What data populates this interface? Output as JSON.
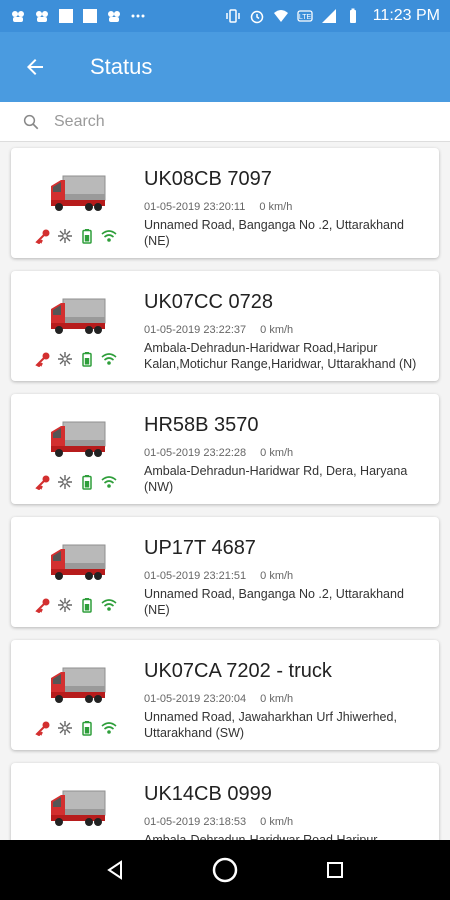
{
  "status_bar": {
    "time": "11:23 PM",
    "icons": [
      "app-notification-icon",
      "app-notification-icon",
      "square-notification-icon",
      "square-notification-icon",
      "app-notification-icon",
      "more-dots-icon",
      "vibrate-icon",
      "alarm-icon",
      "wifi-icon",
      "volte-icon",
      "signal-icon",
      "battery-icon"
    ]
  },
  "app_bar": {
    "title": "Status",
    "back_icon": "arrow-left-icon"
  },
  "search": {
    "placeholder": "Search",
    "value": ""
  },
  "vehicles": [
    {
      "plate": "UK08CB 7097",
      "timestamp": "01-05-2019 23:20:11",
      "speed": "0 km/h",
      "address": "Unnamed Road, Banganga No .2, Uttarakhand (NE)"
    },
    {
      "plate": "UK07CC 0728",
      "timestamp": "01-05-2019 23:22:37",
      "speed": "0 km/h",
      "address": "Ambala-Dehradun-Haridwar Road,Haripur Kalan,Motichur Range,Haridwar, Uttarakhand (N)"
    },
    {
      "plate": "HR58B 3570",
      "timestamp": "01-05-2019 23:22:28",
      "speed": "0 km/h",
      "address": "Ambala-Dehradun-Haridwar Rd, Dera, Haryana (NW)"
    },
    {
      "plate": "UP17T 4687",
      "timestamp": "01-05-2019 23:21:51",
      "speed": "0 km/h",
      "address": "Unnamed Road, Banganga No .2, Uttarakhand (NE)"
    },
    {
      "plate": "UK07CA 7202 - truck",
      "timestamp": "01-05-2019 23:20:04",
      "speed": "0 km/h",
      "address": "Unnamed Road, Jawaharkhan Urf Jhiwerhed, Uttarakhand (SW)"
    },
    {
      "plate": "UK14CB 0999",
      "timestamp": "01-05-2019 23:18:53",
      "speed": "0 km/h",
      "address": "Ambala-Dehradun-Haridwar Road,Haripur"
    }
  ],
  "colors": {
    "status_bar": "#3d8fd9",
    "app_bar": "#4a9be0",
    "ignition_icon": "#d32f2f",
    "battery_icon": "#2e9e3a",
    "signal_icon": "#2e9e3a",
    "truck_body": "#d32f2f"
  },
  "nav_bar": {
    "icons": [
      "back-triangle-icon",
      "home-circle-icon",
      "recents-square-icon"
    ]
  }
}
